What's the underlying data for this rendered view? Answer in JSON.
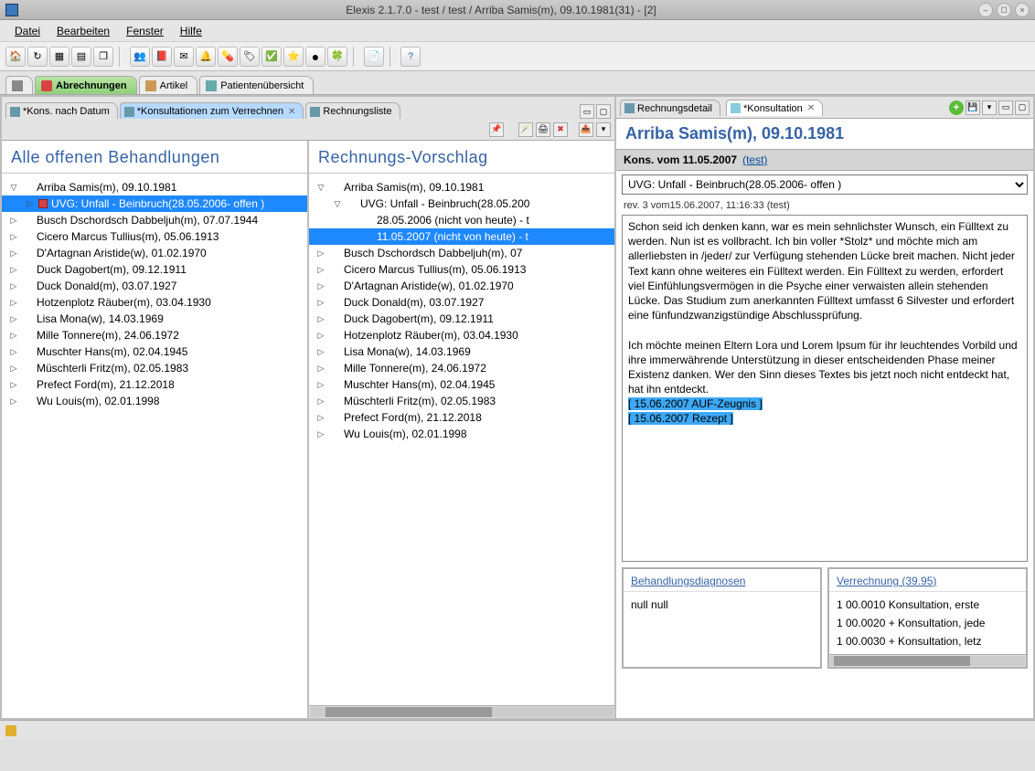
{
  "window": {
    "title": "Elexis 2.1.7.0 -  test / test  / Arriba Samis(m), 09.10.1981(31) - [2]"
  },
  "menu": [
    "Datei",
    "Bearbeiten",
    "Fenster",
    "Hilfe"
  ],
  "perspective_tabs": [
    {
      "label": "Abrechnungen"
    },
    {
      "label": "Artikel"
    },
    {
      "label": "Patientenübersicht"
    }
  ],
  "left_view_tabs": [
    {
      "label": "*Kons. nach Datum"
    },
    {
      "label": "*Konsultationen zum Verrechnen",
      "closeable": true,
      "active": true
    },
    {
      "label": "Rechnungsliste"
    }
  ],
  "left_col": {
    "header": "Alle offenen Behandlungen",
    "items": [
      {
        "label": "Arriba Samis(m), 09.10.1981",
        "expanded": true,
        "level": 0
      },
      {
        "label": "UVG: Unfall - Beinbruch(28.05.2006- offen )",
        "level": 1,
        "selected": true,
        "redicon": true
      },
      {
        "label": "Busch Dschordsch Dabbeljuh(m), 07.07.1944",
        "level": 0
      },
      {
        "label": "Cicero Marcus Tullius(m), 05.06.1913",
        "level": 0
      },
      {
        "label": "D'Artagnan Aristide(w), 01.02.1970",
        "level": 0
      },
      {
        "label": "Duck Dagobert(m), 09.12.1911",
        "level": 0
      },
      {
        "label": "Duck Donald(m), 03.07.1927",
        "level": 0
      },
      {
        "label": "Hotzenplotz Räuber(m), 03.04.1930",
        "level": 0
      },
      {
        "label": "Lisa Mona(w), 14.03.1969",
        "level": 0
      },
      {
        "label": "Mille Tonnere(m), 24.06.1972",
        "level": 0
      },
      {
        "label": "Muschter Hans(m), 02.04.1945",
        "level": 0
      },
      {
        "label": "Müschterli Fritz(m), 02.05.1983",
        "level": 0
      },
      {
        "label": "Prefect Ford(m), 21.12.2018",
        "level": 0
      },
      {
        "label": "Wu Louis(m), 02.01.1998",
        "level": 0
      }
    ]
  },
  "right_col": {
    "header": "Rechnungs-Vorschlag",
    "items": [
      {
        "label": "Arriba Samis(m), 09.10.1981",
        "expanded": true,
        "level": 0
      },
      {
        "label": "UVG: Unfall - Beinbruch(28.05.200",
        "expanded": true,
        "level": 1,
        "arrow": "down"
      },
      {
        "label": "28.05.2006 (nicht von heute) - t",
        "level": 2
      },
      {
        "label": "11.05.2007 (nicht von heute) - t",
        "level": 2,
        "selected": true
      },
      {
        "label": "Busch Dschordsch Dabbeljuh(m), 07",
        "level": 0
      },
      {
        "label": "Cicero Marcus Tullius(m), 05.06.1913",
        "level": 0
      },
      {
        "label": "D'Artagnan Aristide(w), 01.02.1970",
        "level": 0
      },
      {
        "label": "Duck Donald(m), 03.07.1927",
        "level": 0
      },
      {
        "label": "Duck Dagobert(m), 09.12.1911",
        "level": 0
      },
      {
        "label": "Hotzenplotz Räuber(m), 03.04.1930",
        "level": 0
      },
      {
        "label": "Lisa Mona(w), 14.03.1969",
        "level": 0
      },
      {
        "label": "Mille Tonnere(m), 24.06.1972",
        "level": 0
      },
      {
        "label": "Muschter Hans(m), 02.04.1945",
        "level": 0
      },
      {
        "label": "Müschterli Fritz(m), 02.05.1983",
        "level": 0
      },
      {
        "label": "Prefect Ford(m), 21.12.2018",
        "level": 0
      },
      {
        "label": "Wu Louis(m), 02.01.1998",
        "level": 0
      }
    ]
  },
  "right_view_tabs": [
    {
      "label": "Rechnungsdetail"
    },
    {
      "label": "*Konsultation",
      "active": true,
      "closeable": true
    }
  ],
  "patient": {
    "header": "Arriba Samis(m), 09.10.1981",
    "kons_label": "Kons. vom 11.05.2007",
    "kons_link": "(test)",
    "case_select": "UVG: Unfall - Beinbruch(28.05.2006- offen )",
    "rev": "rev. 3 vom15.06.2007, 11:16:33 (test)",
    "notes_p1": "Schon seid ich denken kann, war es mein sehnlichster Wunsch, ein Fülltext zu werden. Nun ist es vollbracht. Ich bin voller *Stolz* und möchte mich am allerliebsten in /jeder/ zur Verfügung stehenden Lücke breit machen. Nicht jeder Text kann ohne weiteres ein Fülltext werden. Ein Fülltext zu werden, erfordert viel Einfühlungsvermögen in die Psyche einer verwaisten allein stehenden Lücke. Das Studium zum anerkannten Fülltext umfasst 6 Silvester und erfordert eine fünfundzwanzigstündige Abschlussprüfung.",
    "notes_p2": "Ich möchte meinen Eltern Lora und Lorem Ipsum für ihr leuchtendes Vorbild und ihre immerwährende Unterstützung in dieser entscheidenden Phase meiner Existenz danken. Wer den Sinn dieses Textes bis jetzt noch nicht entdeckt hat, hat ihn entdeckt.",
    "tag1": "[ 15.06.2007 AUF-Zeugnis ]",
    "tag2": "[ 15.06.2007 Rezept ]"
  },
  "diag": {
    "head": "Behandlungsdiagnosen",
    "body": "null null"
  },
  "billing": {
    "head": "Verrechnung (39.95)",
    "items": [
      "1 00.0010 Konsultation, erste",
      "1 00.0020 + Konsultation, jede",
      "1 00.0030 + Konsultation, letz"
    ]
  }
}
